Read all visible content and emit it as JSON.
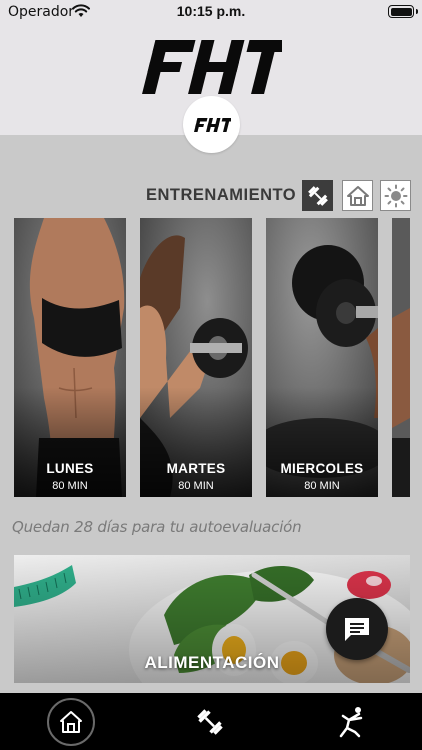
{
  "status_bar": {
    "carrier": "Operador",
    "time": "10:15 p.m."
  },
  "header": {
    "logo_text": "FHT",
    "logo_small_text": "FHT"
  },
  "section": {
    "title": "ENTRENAMIENTO",
    "modes": [
      {
        "icon": "dumbbell-icon",
        "selected": true
      },
      {
        "icon": "home-icon",
        "selected": false
      },
      {
        "icon": "sun-icon",
        "selected": false
      }
    ]
  },
  "days": [
    {
      "day": "LUNES",
      "duration": "80 MIN"
    },
    {
      "day": "MARTES",
      "duration": "80 MIN"
    },
    {
      "day": "MIERCOLES",
      "duration": "80 MIN"
    },
    {
      "day": "",
      "duration": ""
    }
  ],
  "notice": "Quedan 28 días para tu autoevaluación",
  "banner": {
    "title": "ALIMENTACIÓN"
  },
  "tabbar": [
    {
      "icon": "home-icon",
      "active": true
    },
    {
      "icon": "dumbbell-icon",
      "active": false
    },
    {
      "icon": "stretch-icon",
      "active": false
    }
  ],
  "colors": {
    "header_bg": "#e7e5e8",
    "body_bg": "#c9c9c9",
    "selected_mode_bg": "#3c3c3c",
    "tabbar_bg": "#000000"
  }
}
